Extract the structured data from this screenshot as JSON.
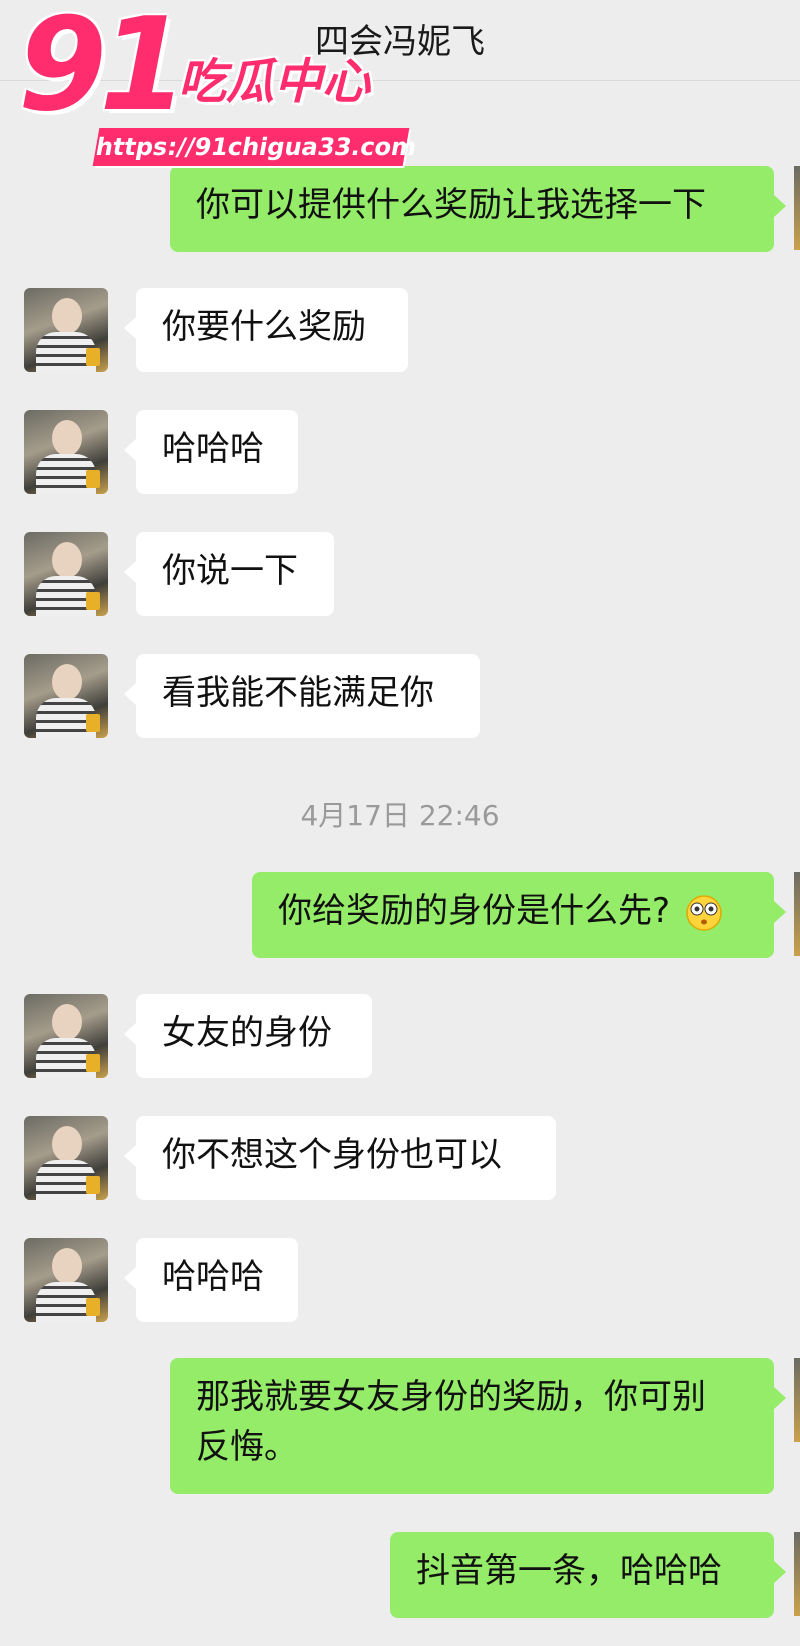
{
  "header": {
    "title": "四会冯妮飞"
  },
  "watermark": {
    "big": "91",
    "text": "吃瓜中心",
    "url": "https://91chigua33.com"
  },
  "messages": [
    {
      "side": "right",
      "text": "你可以提供什么奖励让我选择一下"
    },
    {
      "side": "left",
      "text": "你要什么奖励"
    },
    {
      "side": "left",
      "text": "哈哈哈"
    },
    {
      "side": "left",
      "text": "你说一下"
    },
    {
      "side": "left",
      "text": "看我能不能满足你"
    },
    {
      "side": "right",
      "text": "你给奖励的身份是什么先?",
      "emoji": "flushed-face-emoji"
    },
    {
      "side": "left",
      "text": "女友的身份"
    },
    {
      "side": "left",
      "text": "你不想这个身份也可以"
    },
    {
      "side": "left",
      "text": "哈哈哈"
    },
    {
      "side": "right",
      "text": "那我就要女友身份的奖励，你可别",
      "text2": "反悔。"
    },
    {
      "side": "right",
      "text": "抖音第一条，哈哈哈"
    }
  ],
  "timestamp": "4月17日 22:46",
  "colors": {
    "background": "#ededed",
    "bubble_sent": "#95ec69",
    "bubble_received": "#ffffff",
    "watermark": "#ff2d6d"
  }
}
